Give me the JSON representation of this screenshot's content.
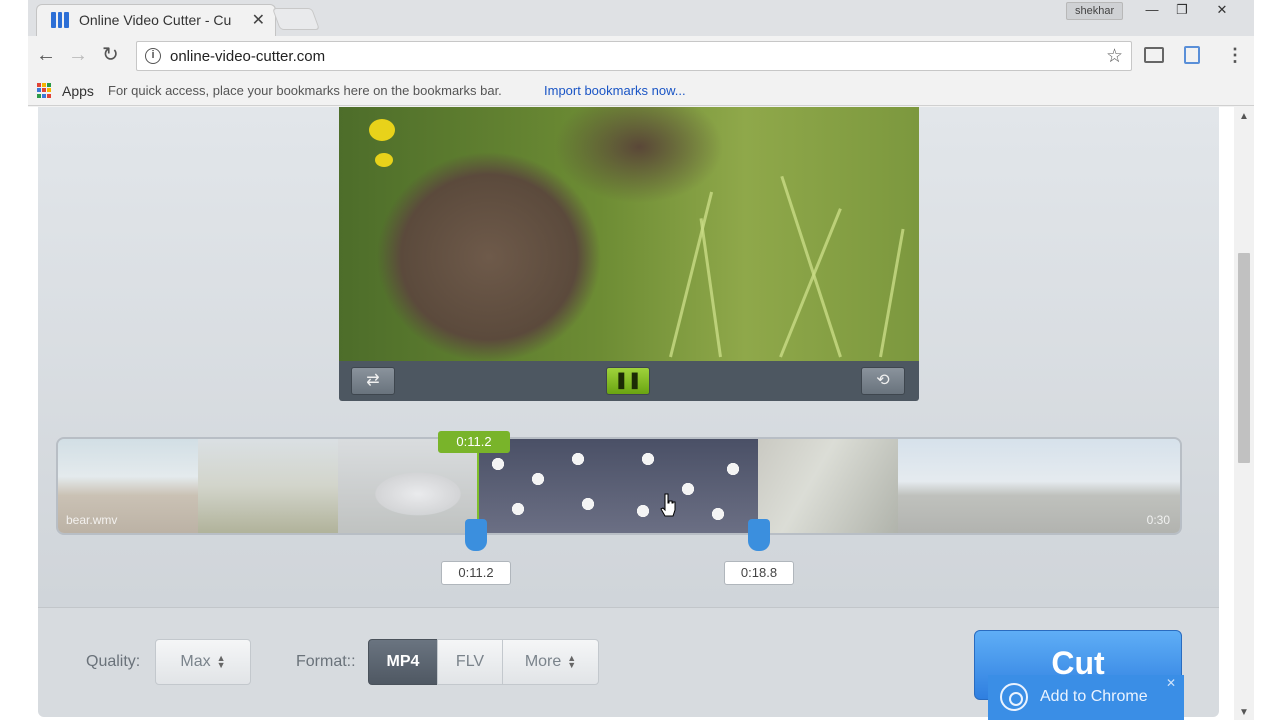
{
  "browser": {
    "tab_title": "Online Video Cutter - Cu",
    "tab_close": "✕",
    "profile_name": "shekhar",
    "window_buttons": [
      "—",
      "❐",
      "✕"
    ],
    "url": "online-video-cutter.com",
    "nav": {
      "back": "←",
      "forward": "→",
      "reload": "↻",
      "info": "i",
      "star": "☆",
      "menu": "⋮"
    },
    "bookmarks": {
      "apps_label": "Apps",
      "hint": "For quick access, place your bookmarks here on the bookmarks bar.",
      "import_link": "Import bookmarks now..."
    },
    "scroll": {
      "up": "▲",
      "down": "▼"
    }
  },
  "player": {
    "controls": {
      "rotate_icon": "⇄",
      "play_pause_icon": "❚❚",
      "reset_icon": "⟲"
    }
  },
  "timeline": {
    "file_name": "bear.wmv",
    "total_duration": "0:30",
    "marker_label": "0:11.2",
    "start_time": "0:11.2",
    "end_time": "0:18.8"
  },
  "settings": {
    "quality_label": "Quality:",
    "quality_value": "Max",
    "format_label": "Format::",
    "formats": [
      "MP4",
      "FLV",
      "More"
    ],
    "active_format": "MP4"
  },
  "actions": {
    "cut_label": "Cut",
    "chrome_banner_label": "Add to Chrome",
    "chrome_banner_close": "✕"
  },
  "colors": {
    "accent_green": "#79b42a",
    "handle_blue": "#3b8fde",
    "cut_blue": "#3a8ee6"
  }
}
